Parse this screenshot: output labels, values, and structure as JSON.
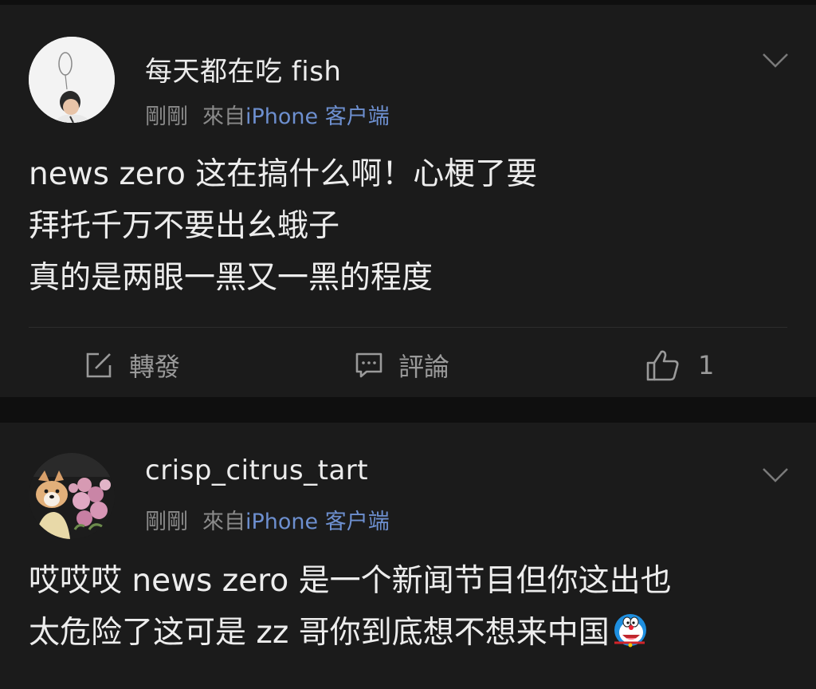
{
  "comments": [
    {
      "username": "每天都在吃 fish",
      "time": "剛剛",
      "from_label": "來自",
      "device": "iPhone 客户端",
      "lines": [
        "news zero 这在搞什么啊！心梗了要",
        "拜托千万不要出幺蛾子",
        "真的是两眼一黑又一黑的程度"
      ],
      "actions": {
        "repost_label": "轉發",
        "comment_label": "評論",
        "like_count": "1"
      }
    },
    {
      "username": "crisp_citrus_tart",
      "time": "剛剛",
      "from_label": "來自",
      "device": "iPhone 客户端",
      "lines": [
        "哎哎哎 news zero 是一个新闻节目但你这出也",
        "太危险了这可是 zz 哥你到底想不想来中国"
      ],
      "emoji": "doraemon-emoji"
    }
  ],
  "icons": {
    "menu": "chevron-down-icon",
    "repost": "share-icon",
    "comment": "comment-icon",
    "like": "thumbs-up-icon"
  },
  "colors": {
    "background": "#0f0f0f",
    "card": "#1b1b1b",
    "device_link": "#6d8fcf"
  }
}
